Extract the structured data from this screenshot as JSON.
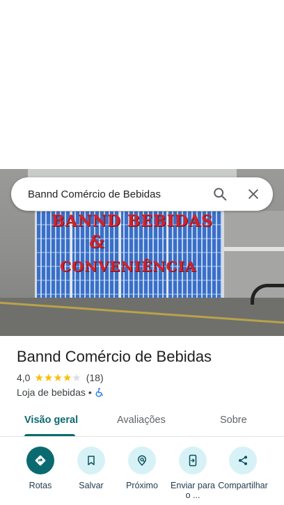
{
  "search": {
    "query": "Bannd Comércio de Bebidas"
  },
  "photo": {
    "sign_line1": "BANND BEBIDAS",
    "sign_amp": "&",
    "sign_line2": "CONVENIÊNCIA"
  },
  "place": {
    "title": "Bannd Comércio de Bebidas",
    "rating": "4,0",
    "rating_value": 4.0,
    "review_count": "(18)",
    "category": "Loja de bebidas",
    "separator": "•"
  },
  "tabs": [
    {
      "label": "Visão geral",
      "active": true
    },
    {
      "label": "Avaliações",
      "active": false
    },
    {
      "label": "Sobre",
      "active": false
    }
  ],
  "actions": [
    {
      "label": "Rotas",
      "icon": "directions-icon"
    },
    {
      "label": "Salvar",
      "icon": "bookmark-icon"
    },
    {
      "label": "Próximo",
      "icon": "nearby-icon"
    },
    {
      "label": "Enviar para o ...",
      "icon": "send-to-phone-icon"
    },
    {
      "label": "Compartilhar",
      "icon": "share-icon"
    }
  ],
  "colors": {
    "accent": "#0b6a70",
    "action_bg": "#d7f2f6",
    "star": "#fbbc04",
    "accessibility": "#1a73e8"
  }
}
